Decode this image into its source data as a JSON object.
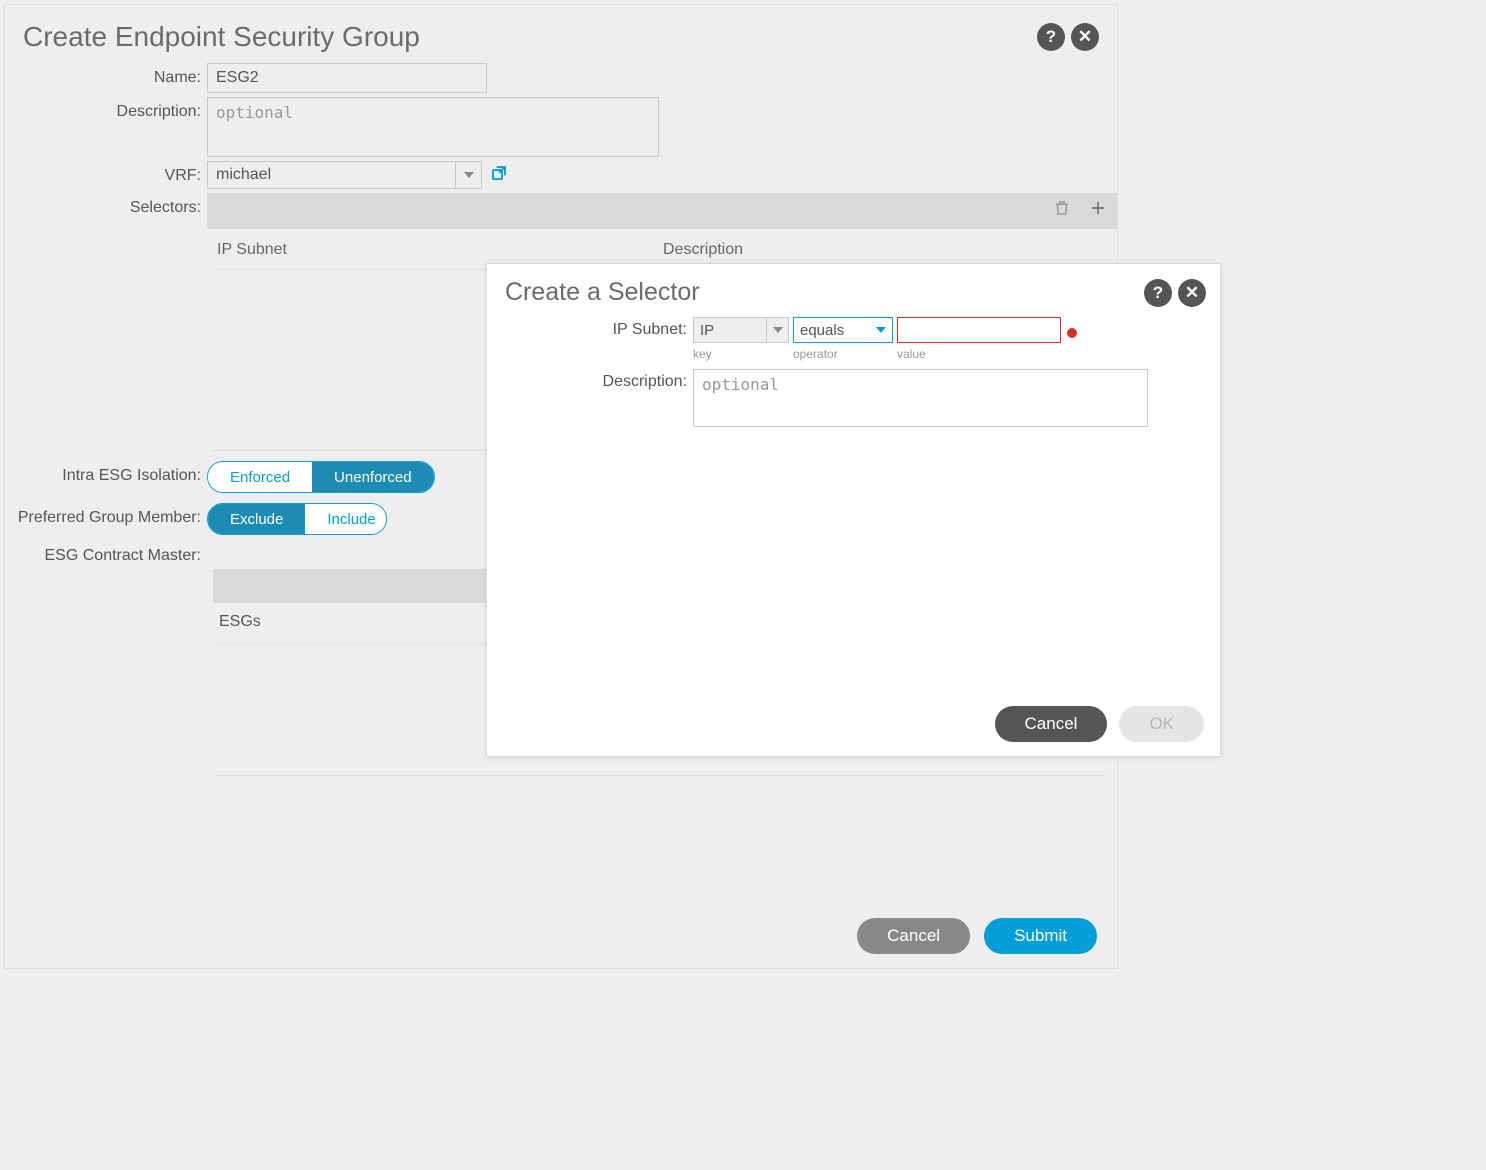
{
  "main": {
    "title": "Create Endpoint Security Group",
    "labels": {
      "name": "Name:",
      "description": "Description:",
      "vrf": "VRF:",
      "selectors": "Selectors:",
      "intra": "Intra ESG Isolation:",
      "pgm": "Preferred Group Member:",
      "ecm": "ESG Contract Master:"
    },
    "name_value": "ESG2",
    "description_placeholder": "optional",
    "vrf_value": "michael",
    "table": {
      "col_ip": "IP Subnet",
      "col_desc": "Description"
    },
    "intra": {
      "enforced": "Enforced",
      "unenforced": "Unenforced"
    },
    "pgm": {
      "exclude": "Exclude",
      "include": "Include"
    },
    "esgs_header": "ESGs",
    "buttons": {
      "cancel": "Cancel",
      "submit": "Submit"
    }
  },
  "sub": {
    "title": "Create a Selector",
    "labels": {
      "ip_subnet": "IP Subnet:",
      "description": "Description:"
    },
    "key_value": "IP",
    "operator_value": "equals",
    "value_value": "",
    "hints": {
      "key": "key",
      "operator": "operator",
      "value": "value"
    },
    "description_placeholder": "optional",
    "buttons": {
      "cancel": "Cancel",
      "ok": "OK"
    }
  }
}
